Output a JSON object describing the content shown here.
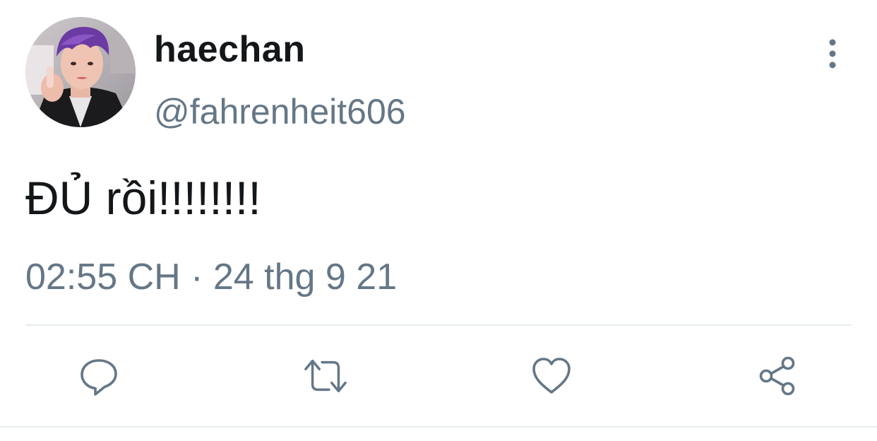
{
  "user": {
    "display_name": "haechan",
    "handle": "@fahrenheit606",
    "avatar_icon": "profile-photo"
  },
  "tweet": {
    "text": "ĐỦ rồi!!!!!!!!",
    "timestamp": "02:55 CH · 24 thg 9 21"
  },
  "actions": {
    "reply_icon": "reply-bubble-icon",
    "retweet_icon": "retweet-arrows-icon",
    "like_icon": "heart-icon",
    "share_icon": "share-nodes-icon",
    "more_icon": "vertical-dots-icon"
  },
  "colors": {
    "primary_text": "#14171a",
    "secondary_text": "#657786",
    "icon": "#657786",
    "divider": "#e6ecf0"
  }
}
